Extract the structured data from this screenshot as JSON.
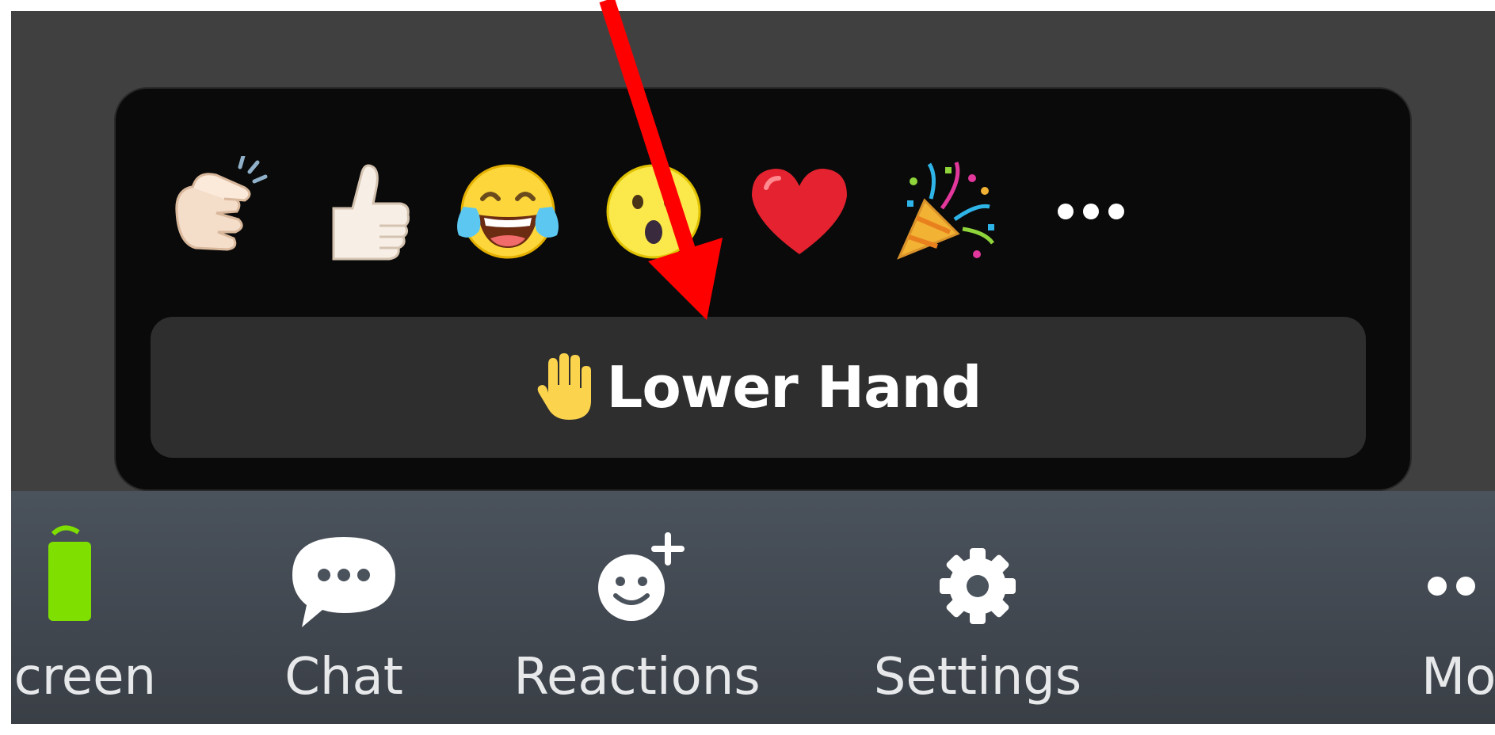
{
  "popup": {
    "emojis": [
      {
        "name": "clapping-hands-icon"
      },
      {
        "name": "thumbs-up-icon"
      },
      {
        "name": "tears-of-joy-icon"
      },
      {
        "name": "open-mouth-icon"
      },
      {
        "name": "red-heart-icon"
      },
      {
        "name": "party-popper-icon"
      },
      {
        "name": "more-reactions-icon"
      }
    ],
    "lower_hand_label": "Lower Hand"
  },
  "toolbar": {
    "items": [
      {
        "label": "Screen",
        "icon": "share-screen-icon"
      },
      {
        "label": "Chat",
        "icon": "chat-bubble-icon"
      },
      {
        "label": "Reactions",
        "icon": "smiley-plus-icon"
      },
      {
        "label": "Settings",
        "icon": "gear-icon"
      },
      {
        "label": "Mo",
        "icon": "more-dots-icon"
      }
    ]
  },
  "colors": {
    "screen_bg": "#404040",
    "popup_bg": "#0a0a0a",
    "button_bg": "#2e2e2e",
    "toolbar_bg": "#454b53",
    "annotation_red": "#ff0000",
    "share_green": "#7fe000"
  }
}
